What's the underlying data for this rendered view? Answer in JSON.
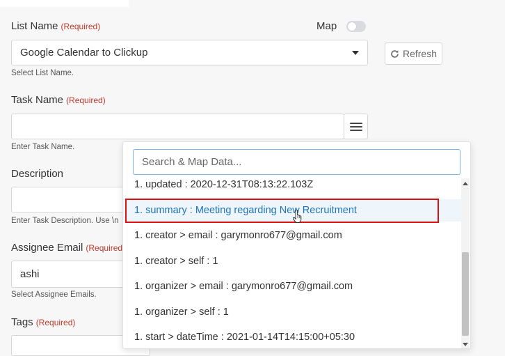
{
  "form": {
    "list_name": {
      "label": "List Name",
      "required": "(Required)",
      "value": "Google Calendar to Clickup",
      "hint": "Select List Name."
    },
    "map": {
      "label": "Map"
    },
    "refresh_label": "Refresh",
    "task_name": {
      "label": "Task Name",
      "required": "(Required)",
      "value": "",
      "hint": "Enter Task Name."
    },
    "description": {
      "label": "Description",
      "hint": "Enter Task Description. Use \\n"
    },
    "assignee_email": {
      "label": "Assignee Email",
      "required": "(Required",
      "value": "ashi",
      "hint": "Select Assignee Emails."
    },
    "tags": {
      "label": "Tags",
      "required": "(Required)"
    }
  },
  "dropdown": {
    "search_placeholder": "Search & Map Data...",
    "options": [
      {
        "label": "1. updated : 2020-12-31T08:13:22.103Z"
      },
      {
        "label": "1. summary : Meeting regarding New Recruitment"
      },
      {
        "label": "1. creator > email : garymonro677@gmail.com"
      },
      {
        "label": "1. creator > self : 1"
      },
      {
        "label": "1. organizer > email : garymonro677@gmail.com"
      },
      {
        "label": "1. organizer > self : 1"
      },
      {
        "label": "1. start > dateTime : 2021-01-14T14:15:00+05:30"
      }
    ]
  },
  "colors": {
    "required": "#c0392b",
    "highlight_text": "#1f73b7",
    "highlight_border": "#e01010",
    "search_border": "#7cb5e0"
  },
  "icons": {
    "refresh": "refresh-icon",
    "map_menu": "menu-icon",
    "select_caret": "chevron-down-icon",
    "cursor": "hand-cursor-icon"
  }
}
